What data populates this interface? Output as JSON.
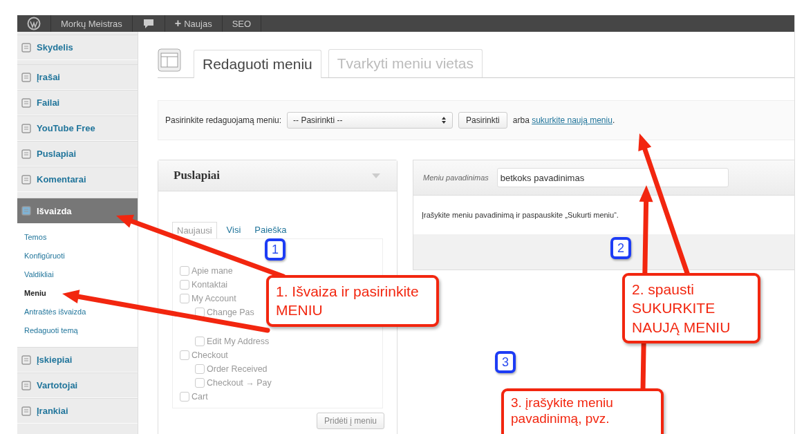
{
  "admin_bar": {
    "site_name": "Morkų Meistras",
    "new_label": "Naujas",
    "plus": "+",
    "seo": "SEO"
  },
  "sidebar": {
    "items": [
      {
        "label": "Skydelis",
        "selected": false
      },
      {
        "label": "Įrašai",
        "selected": false
      },
      {
        "label": "Failai",
        "selected": false
      },
      {
        "label": "YouTube Free",
        "selected": false
      },
      {
        "label": "Puslapiai",
        "selected": false
      },
      {
        "label": "Komentarai",
        "selected": false
      },
      {
        "label": "Išvaizda",
        "selected": true,
        "children": [
          {
            "label": "Temos",
            "selected": false
          },
          {
            "label": "Konfigūruoti",
            "selected": false
          },
          {
            "label": "Valdikliai",
            "selected": false
          },
          {
            "label": "Meniu",
            "selected": true
          },
          {
            "label": "Antraštės išvaizda",
            "selected": false
          },
          {
            "label": "Redaguoti temą",
            "selected": false
          }
        ]
      },
      {
        "label": "Įskiepiai",
        "selected": false
      },
      {
        "label": "Vartotojai",
        "selected": false
      },
      {
        "label": "Įrankiai",
        "selected": false
      }
    ]
  },
  "tabs": [
    {
      "label": "Redaguoti meniu",
      "selected": true
    },
    {
      "label": "Tvarkyti meniu vietas",
      "selected": false
    }
  ],
  "menu_select": {
    "label": "Pasirinkite redaguojamą meniu:",
    "value": "-- Pasirinkti --",
    "button": "Pasirinkti",
    "before_link": "arba",
    "link": "sukurkite naują meniu",
    "after_link": "."
  },
  "pages_panel": {
    "title": "Puslapiai",
    "tabs": [
      {
        "label": "Naujausi",
        "selected": true
      },
      {
        "label": "Visi",
        "selected": false
      },
      {
        "label": "Paieška",
        "selected": false
      }
    ],
    "items": [
      {
        "label": "Apie mane",
        "checked": false
      },
      {
        "label": "Kontaktai",
        "checked": false
      },
      {
        "label": "My Account",
        "checked": false,
        "children": [
          {
            "label": "Change Pas",
            "checked": false
          },
          {
            "label": "Edit My Address",
            "checked": false
          }
        ]
      },
      {
        "label": "Checkout",
        "checked": false,
        "children": [
          {
            "label": "Order Received",
            "checked": false
          },
          {
            "label": "Checkout → Pay",
            "checked": false
          }
        ]
      },
      {
        "label": "Cart",
        "checked": false
      }
    ],
    "button": "Pridėti į meniu",
    "button_disabled": true
  },
  "menu_name_panel": {
    "label": "Meniu pavadinimas",
    "value": "betkoks pavadinimas",
    "hint": "Įrašykite meniu pavadinimą ir paspauskite „Sukurti meniu“."
  },
  "annotations": [
    {
      "number": "1",
      "text": "1.  Išvaiza ir pasirinkite MENIU"
    },
    {
      "number": "2",
      "text": "2. spausti SUKURKITE NAUJĄ MENIU"
    },
    {
      "number": "3",
      "text": "3. įrašykite meniu pavadinimą, pvz."
    }
  ]
}
